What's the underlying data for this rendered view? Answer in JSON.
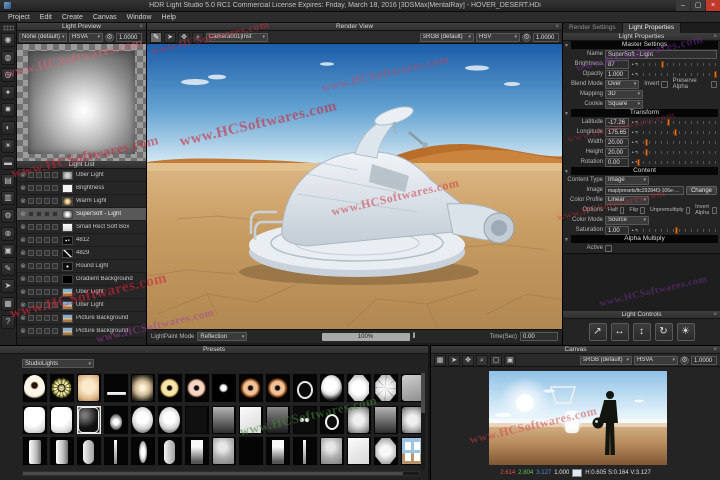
{
  "watermark": "www.HCSoftwares.com",
  "window": {
    "title": "HDR Light Studio 5.0 RC1 Commercial License Expires: Friday, March 18, 2016  [3DSMax|MentalRay] - HOVER_DESERT.HDi",
    "controls": {
      "minimize": "–",
      "maximize": "▢",
      "close": "×"
    },
    "menus": [
      "Project",
      "Edit",
      "Create",
      "Canvas",
      "Window",
      "Help"
    ]
  },
  "left_toolbar": {
    "tools": [
      {
        "name": "round-soft-light",
        "glyph": "◉"
      },
      {
        "name": "sphere-light",
        "glyph": "◍"
      },
      {
        "name": "spot-light",
        "glyph": "◎"
      },
      {
        "name": "cookie-light",
        "glyph": "✦"
      },
      {
        "name": "gobo-wheel",
        "glyph": "✹"
      },
      {
        "name": "scrim-light",
        "glyph": "◐"
      },
      {
        "name": "sun-light",
        "glyph": "☀"
      },
      {
        "name": "strip-light",
        "glyph": "▬"
      },
      {
        "name": "panel-light",
        "glyph": "▤"
      },
      {
        "name": "gradient-light",
        "glyph": "▥"
      },
      {
        "name": "settings-gear",
        "glyph": "⚙"
      },
      {
        "name": "delete-light",
        "glyph": "⊗"
      },
      {
        "name": "frame-light",
        "glyph": "▣"
      },
      {
        "name": "brush-light",
        "glyph": "✎"
      },
      {
        "name": "arrow-light",
        "glyph": "➤"
      },
      {
        "name": "picture-light",
        "glyph": "▦"
      },
      {
        "name": "help-tool",
        "glyph": "?"
      }
    ]
  },
  "light_preview": {
    "title": "Light Preview",
    "colorspace": "None (default)",
    "channel": "HSVA",
    "exposure": "1.0000"
  },
  "light_list": {
    "title": "Light List",
    "items": [
      {
        "name": "Uber Light",
        "thumb": "gray",
        "selected": false
      },
      {
        "name": "Brightness",
        "thumb": "white",
        "selected": false
      },
      {
        "name": "Warm Light",
        "thumb": "warm",
        "selected": false
      },
      {
        "name": "SuperSoft - Light",
        "thumb": "glow",
        "selected": true
      },
      {
        "name": "Small Rect Soft Box",
        "thumb": "rect",
        "selected": false
      },
      {
        "name": "4812",
        "thumb": "specks",
        "selected": false
      },
      {
        "name": "4829",
        "thumb": "arc",
        "selected": false
      },
      {
        "name": "Round Light",
        "thumb": "dot",
        "selected": false
      },
      {
        "name": "Gradient Background",
        "thumb": "black",
        "selected": false
      },
      {
        "name": "Uber Light",
        "thumb": "photo",
        "selected": false
      },
      {
        "name": "Uber Light",
        "thumb": "photo",
        "selected": false
      },
      {
        "name": "Picture Background",
        "thumb": "photo",
        "selected": false
      },
      {
        "name": "Picture Background",
        "thumb": "photo",
        "selected": false
      }
    ]
  },
  "render_view": {
    "title": "Render View",
    "tools": [
      {
        "name": "lightpaint-brush",
        "glyph": "✎",
        "active": true
      },
      {
        "name": "select-arrow",
        "glyph": "➤",
        "active": false
      },
      {
        "name": "pan-hand",
        "glyph": "✥",
        "active": false
      },
      {
        "name": "zoom-magnifier",
        "glyph": "⌕",
        "active": false
      }
    ],
    "camera": "Camera001|Inst",
    "colorspace": "sRGB (default)",
    "channel": "HSV",
    "exposure": "1.0000",
    "lightpaint_label": "LightPaint Mode",
    "lightpaint_mode": "Reflection",
    "progress": "100%",
    "pause": "‖",
    "time_label": "Time(Sec)",
    "time_value": "0.00"
  },
  "properties": {
    "tabs": [
      {
        "label": "Render Settings",
        "active": false
      },
      {
        "label": "Light Properties",
        "active": true
      }
    ],
    "panel_title": "Light Properties",
    "master": {
      "section": "Master Settings",
      "name_label": "Name",
      "name_value": "SuperSoft - Light",
      "brightness_label": "Brightness",
      "brightness_value": "87",
      "brightness_pct": 32,
      "opacity_label": "Opacity",
      "opacity_value": "1.000",
      "opacity_pct": 99,
      "blend_label": "Blend Mode",
      "blend_value": "Over",
      "invert_label": "Invert",
      "preserve_alpha_label": "Preserve Alpha",
      "mapping_label": "Mapping",
      "mapping_value": "3D",
      "cookie_label": "Cookie",
      "cookie_value": "Square"
    },
    "transform": {
      "section": "Transform",
      "rows": [
        {
          "label": "Latitude",
          "value": "-17.26",
          "pct": 40
        },
        {
          "label": "Longitude",
          "value": "175.65",
          "pct": 49
        },
        {
          "label": "Width",
          "value": "20.00",
          "pct": 13
        },
        {
          "label": "Height",
          "value": "20.00",
          "pct": 13
        },
        {
          "label": "Rotation",
          "value": "0.00",
          "pct": 2
        }
      ]
    },
    "content": {
      "section": "Content",
      "type_label": "Content Type",
      "type_value": "Image",
      "image_label": "Image",
      "image_path": "map/presets/ltc29284f3-106e-4c01-8d28-f5f07066a757.tx",
      "change_label": "Change",
      "profile_label": "Color Profile",
      "profile_value": "Linear",
      "options_label": "Options",
      "options": [
        "Half",
        "Flip",
        "Unpremultiply",
        "Invert Alpha"
      ],
      "color_mode_label": "Color Mode",
      "color_mode_value": "Source",
      "saturation_label": "Saturation",
      "saturation_value": "1.00",
      "saturation_pct": 50
    },
    "alpha": {
      "section": "Alpha Multiply",
      "active_label": "Active"
    }
  },
  "light_controls": {
    "title": "Light Controls",
    "buttons": [
      {
        "name": "scale-control",
        "glyph": "↗"
      },
      {
        "name": "width-control",
        "glyph": "↔"
      },
      {
        "name": "height-control",
        "glyph": "↕"
      },
      {
        "name": "rotate-control",
        "glyph": "↻"
      },
      {
        "name": "brightness-control",
        "glyph": "☀"
      }
    ]
  },
  "presets": {
    "title": "Presets",
    "category": "StudioLights",
    "selected_cell": {
      "row": 1,
      "col": 2
    },
    "rows": [
      [
        "ring-dark",
        "gear",
        "softbox-warm",
        "strip-h",
        "glow-sq",
        "donut-yellow",
        "donut-pink",
        "dot",
        "donut-copper",
        "donut-copper",
        "ring-thin",
        "blob",
        "octagon",
        "octagon-spoke",
        "sq-gray"
      ],
      [
        "rounded-white",
        "rounded-white",
        "rounded-outline",
        "oval-glow",
        "circle-soft",
        "circle-soft",
        "dark",
        "grad-sq",
        "bright-sq",
        "grad-sq-dark",
        "twin-dots",
        "ring-small",
        "soft-sq",
        "grad-sq",
        "soft-sq"
      ],
      [
        "vbar",
        "vbar",
        "vrounded",
        "thin-vstrip",
        "voval",
        "vrounded",
        "vgrad",
        "sq-tex",
        "sq-bright",
        "vgrad",
        "thin-vstrip",
        "sq-tex",
        "bright-sq",
        "octagon-soft",
        "window-blue"
      ]
    ]
  },
  "canvas": {
    "title": "Canvas",
    "tools": [
      {
        "name": "move-grid",
        "glyph": "▦"
      },
      {
        "name": "select-arrow",
        "glyph": "➤"
      },
      {
        "name": "pan-hand",
        "glyph": "✥"
      },
      {
        "name": "zoom-magnifier",
        "glyph": "⌕"
      },
      {
        "name": "fit-view",
        "glyph": "▢"
      },
      {
        "name": "expand-view",
        "glyph": "▣"
      }
    ],
    "colorspace": "sRGB (default)",
    "channel": "HSVA",
    "exposure": "1.0000",
    "status": {
      "r": "2.614",
      "g": "2.804",
      "b": "3.127",
      "a": "1.000",
      "hsv": "H:0.605 S:0.164 V:3.127"
    }
  }
}
